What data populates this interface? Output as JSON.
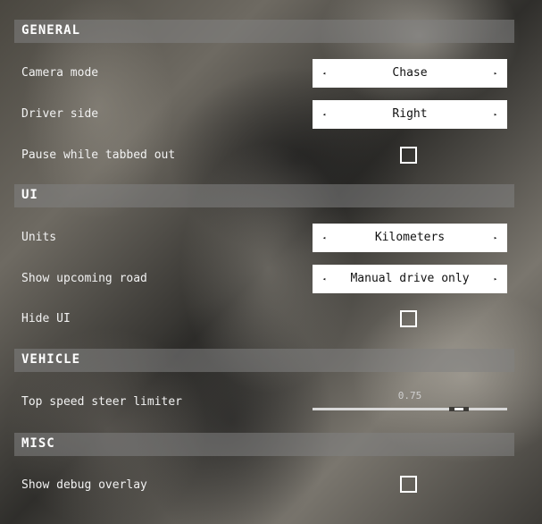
{
  "sections": {
    "general": {
      "title": "GENERAL",
      "camera_mode": {
        "label": "Camera mode",
        "value": "Chase",
        "prev": "◂",
        "next": "▸"
      },
      "driver_side": {
        "label": "Driver side",
        "value": "Right",
        "prev": "◂",
        "next": "▸"
      },
      "pause_tabbed": {
        "label": "Pause while tabbed out",
        "checked": false
      }
    },
    "ui": {
      "title": "UI",
      "units": {
        "label": "Units",
        "value": "Kilometers",
        "prev": "◂",
        "next": "▸"
      },
      "upcoming_road": {
        "label": "Show upcoming road",
        "value": "Manual drive only",
        "prev": "◂",
        "next": "▸"
      },
      "hide_ui": {
        "label": "Hide UI",
        "checked": false
      }
    },
    "vehicle": {
      "title": "VEHICLE",
      "steer_limiter": {
        "label": "Top speed steer limiter",
        "value": "0.75",
        "fraction": 0.75
      }
    },
    "misc": {
      "title": "MISC",
      "debug_overlay": {
        "label": "Show debug overlay",
        "checked": false
      }
    }
  },
  "colors": {
    "section_bg": "#828282",
    "selector_bg": "#ffffff",
    "text": "#ffffff"
  }
}
